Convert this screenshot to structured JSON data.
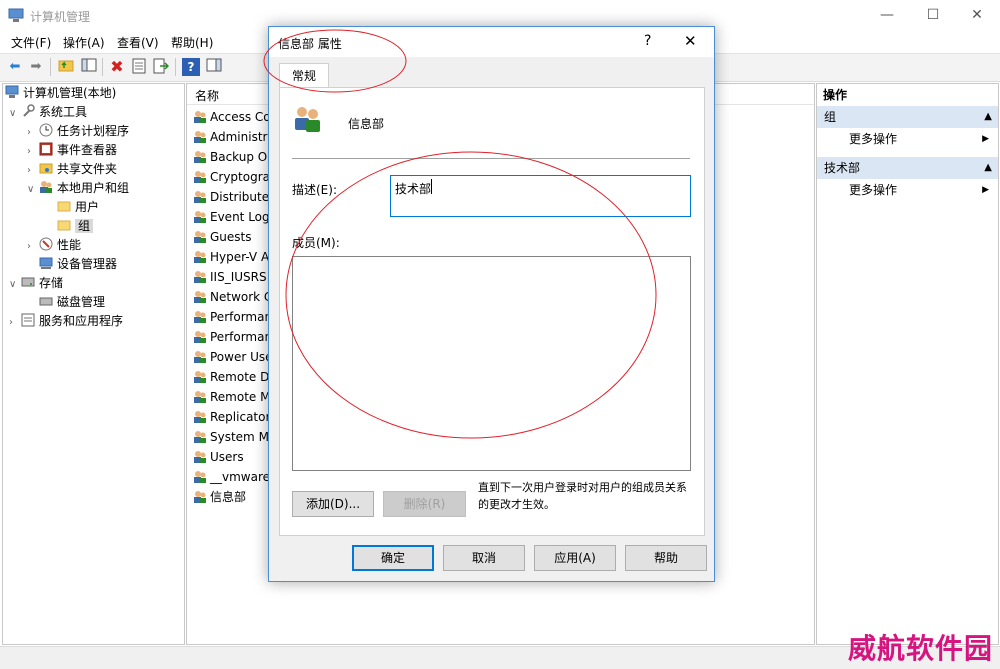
{
  "window": {
    "title": "计算机管理",
    "controls": {
      "minimize": "—",
      "maximize": "☐",
      "close": "✕"
    }
  },
  "menubar": [
    "文件(F)",
    "操作(A)",
    "查看(V)",
    "帮助(H)"
  ],
  "toolbar_icons": [
    "back-icon",
    "forward-icon",
    "up-folder-icon",
    "show-hide-tree-icon",
    "delete-icon",
    "properties-icon",
    "export-icon",
    "help-icon",
    "action-pane-icon"
  ],
  "tree": [
    {
      "label": "计算机管理(本地)",
      "level": 0,
      "expander": ""
    },
    {
      "label": "系统工具",
      "level": 1,
      "expander": "∨"
    },
    {
      "label": "任务计划程序",
      "level": 2,
      "expander": "›"
    },
    {
      "label": "事件查看器",
      "level": 2,
      "expander": "›"
    },
    {
      "label": "共享文件夹",
      "level": 2,
      "expander": "›"
    },
    {
      "label": "本地用户和组",
      "level": 2,
      "expander": "∨"
    },
    {
      "label": "用户",
      "level": 3,
      "expander": ""
    },
    {
      "label": "组",
      "level": 3,
      "expander": ""
    },
    {
      "label": "性能",
      "level": 2,
      "expander": "›"
    },
    {
      "label": "设备管理器",
      "level": 2,
      "expander": ""
    },
    {
      "label": "存储",
      "level": 1,
      "expander": "∨"
    },
    {
      "label": "磁盘管理",
      "level": 2,
      "expander": ""
    },
    {
      "label": "服务和应用程序",
      "level": 1,
      "expander": "›"
    }
  ],
  "list": {
    "header": "名称",
    "rows": [
      "Access Cor",
      "Administra",
      "Backup Op",
      "Cryptograp",
      "Distributed",
      "Event Log",
      "Guests",
      "Hyper-V Ad",
      "IIS_IUSRS",
      "Network C",
      "Performanc",
      "Performanc",
      "Power Use",
      "Remote De",
      "Remote M",
      "Replicator",
      "System Ma",
      "Users",
      "__vmware_",
      "信息部"
    ]
  },
  "actions": {
    "header": "操作",
    "sections": [
      {
        "title": "组",
        "item": "更多操作"
      },
      {
        "title": "技术部",
        "item": "更多操作"
      }
    ]
  },
  "dialog": {
    "title": "信息部 属性",
    "help_glyph": "?",
    "close_glyph": "✕",
    "tab": "常规",
    "group_name": "信息部",
    "description_label": "描述(E):",
    "description_value": "技术部",
    "members_label": "成员(M):",
    "add_button": "添加(D)...",
    "remove_button": "删除(R)",
    "note": "直到下一次用户登录时对用户的组成员关系的更改才生效。",
    "ok": "确定",
    "cancel": "取消",
    "apply": "应用(A)",
    "help": "帮助"
  },
  "watermark": "威航软件园",
  "colors": {
    "accent": "#0078d7",
    "annotation_red": "#e0202a",
    "watermark": "#d6147f",
    "action_section_bg": "#dbe6f4"
  }
}
